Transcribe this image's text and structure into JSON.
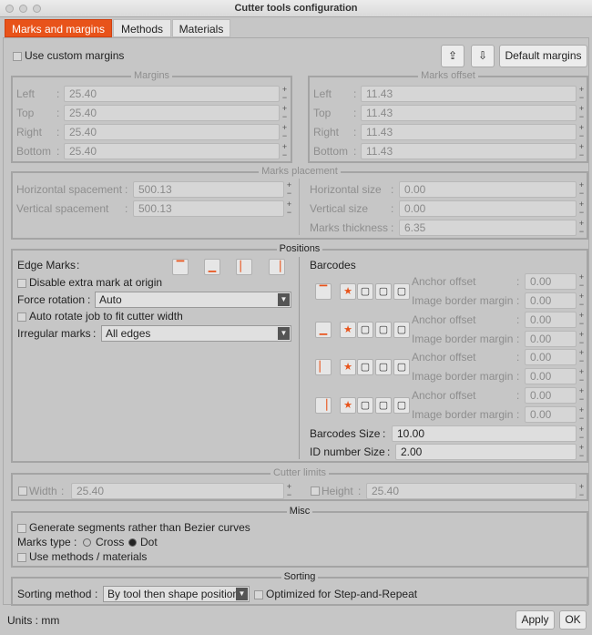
{
  "window": {
    "title": "Cutter tools configuration"
  },
  "tabs": [
    {
      "label": "Marks and margins",
      "active": true
    },
    {
      "label": "Methods"
    },
    {
      "label": "Materials"
    }
  ],
  "top": {
    "use_custom_margins": "Use custom margins",
    "default_margins": "Default margins"
  },
  "margins": {
    "title": "Margins",
    "rows": [
      {
        "label": "Left",
        "value": "25.40"
      },
      {
        "label": "Top",
        "value": "25.40"
      },
      {
        "label": "Right",
        "value": "25.40"
      },
      {
        "label": "Bottom",
        "value": "25.40"
      }
    ]
  },
  "marks_offset": {
    "title": "Marks offset",
    "rows": [
      {
        "label": "Left",
        "value": "11.43"
      },
      {
        "label": "Top",
        "value": "11.43"
      },
      {
        "label": "Right",
        "value": "11.43"
      },
      {
        "label": "Bottom",
        "value": "11.43"
      }
    ]
  },
  "marks_placement": {
    "title": "Marks placement",
    "left": [
      {
        "label": "Horizontal spacement",
        "value": "500.13"
      },
      {
        "label": "Vertical spacement",
        "value": "500.13"
      }
    ],
    "right": [
      {
        "label": "Horizontal size",
        "value": "0.00"
      },
      {
        "label": "Vertical size",
        "value": "0.00"
      },
      {
        "label": "Marks thickness",
        "value": "6.35"
      }
    ]
  },
  "positions": {
    "title": "Positions",
    "edge_marks": "Edge Marks",
    "disable_extra": "Disable extra mark at origin",
    "force_rotation_label": "Force rotation",
    "force_rotation": "Auto",
    "auto_rotate": "Auto rotate job to fit cutter width",
    "irregular_label": "Irregular marks",
    "irregular": "All edges",
    "barcodes": "Barcodes",
    "anchor_offset": "Anchor offset",
    "image_border": "Image border margin",
    "barcode_rows": [
      {
        "anchor": "0.00",
        "border": "0.00"
      },
      {
        "anchor": "0.00",
        "border": "0.00"
      },
      {
        "anchor": "0.00",
        "border": "0.00"
      },
      {
        "anchor": "0.00",
        "border": "0.00"
      }
    ],
    "barcodes_size_label": "Barcodes Size",
    "barcodes_size": "10.00",
    "id_size_label": "ID number Size",
    "id_size": "2.00"
  },
  "cutter_limits": {
    "title": "Cutter limits",
    "width_label": "Width",
    "width": "25.40",
    "height_label": "Height",
    "height": "25.40"
  },
  "misc": {
    "title": "Misc",
    "segments": "Generate segments rather than Bezier curves",
    "marks_type_label": "Marks type",
    "cross": "Cross",
    "dot": "Dot",
    "selected": "Dot",
    "use_methods": "Use methods / materials"
  },
  "sorting": {
    "title": "Sorting",
    "method_label": "Sorting method",
    "method": "By tool then shape position",
    "optimized": "Optimized for Step-and-Repeat"
  },
  "footer": {
    "units": "Units : mm",
    "apply": "Apply",
    "ok": "OK"
  },
  "colors": {
    "accent": "#e8531a"
  }
}
